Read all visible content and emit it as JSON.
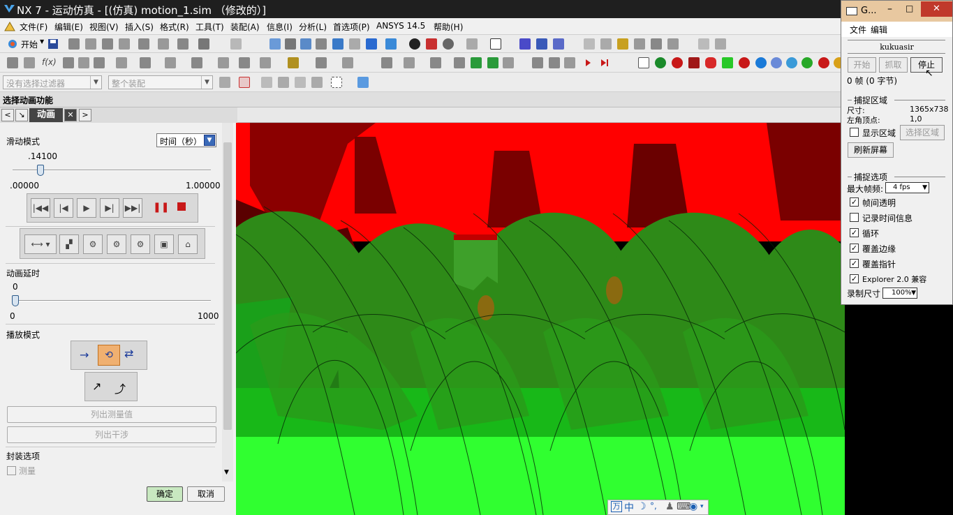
{
  "window": {
    "title": "NX 7 - 运动仿真 - [(仿真) motion_1.sim （修改的）]"
  },
  "menu": [
    "文件(F)",
    "编辑(E)",
    "视图(V)",
    "插入(S)",
    "格式(R)",
    "工具(T)",
    "装配(A)",
    "信息(I)",
    "分析(L)",
    "首选项(P)",
    "ANSYS 14.5",
    "帮助(H)"
  ],
  "toolbar": {
    "start_label": "开始",
    "filter_placeholder": "没有选择过滤器",
    "assembly_placeholder": "整个装配"
  },
  "cue_line": "选择动画功能",
  "tab": {
    "label": "动画"
  },
  "panel": {
    "slider_mode_label": "滑动模式",
    "time_select": "时间（秒）",
    "time_value": ".14100",
    "time_value_fraction": 0.141,
    "time_min": ".00000",
    "time_max": "1.00000",
    "delay_label": "动画延时",
    "delay_value": "0",
    "delay_value_fraction": 0,
    "delay_min": "0",
    "delay_max": "1000",
    "playback_mode_label": "播放模式",
    "list_measures_button": "列出测量值",
    "list_interference_button": "列出干涉",
    "packaging_label": "封装选项",
    "measure_checkbox": "测量",
    "ok_button": "确定",
    "cancel_button": "取消"
  },
  "ime": {
    "mode": "中"
  },
  "capture": {
    "title": "G...",
    "menu_file": "文件",
    "menu_edit": "编辑",
    "brand": "kukuasir",
    "start_button": "开始",
    "grab_button": "抓取",
    "stop_button": "停止",
    "frame_info": "0 帧 (0 字节)",
    "area_title": "捕捉区域",
    "size_label": "尺寸:",
    "size_value": "1365x738",
    "topleft_label": "左角顶点:",
    "topleft_value": "1,0",
    "show_area_label": "显示区域",
    "select_area_button": "选择区域",
    "refresh_button": "刷新屏幕",
    "options_title": "捕捉选项",
    "max_fps_label": "最大帧频:",
    "max_fps_value": "4 fps",
    "opt_transparent": "帧间透明",
    "opt_record_time": "记录时间信息",
    "opt_loop": "循环",
    "opt_edges": "覆盖边缘",
    "opt_pointer": "覆盖指针",
    "opt_explorer": "Explorer 2.0 兼容",
    "rec_size_label": "录制尺寸",
    "rec_size_value": "100%"
  }
}
